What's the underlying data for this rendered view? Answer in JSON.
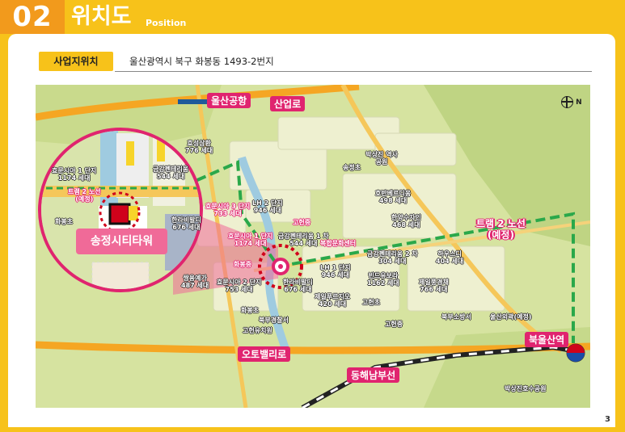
{
  "header": {
    "number": "02",
    "title": "위치도",
    "subtitle": "Position"
  },
  "location": {
    "tab_label": "사업지위치",
    "address": "울산광역시 북구 화봉동 1493-2번지"
  },
  "page_number": "3",
  "map": {
    "compass": "N",
    "roads": {
      "airport": "울산공항",
      "sanup": "산업로",
      "otovalley": "오토밸리로",
      "donghae": "동해남부선",
      "station": "북울산역"
    },
    "tram": {
      "line1": "트램 2 노선",
      "line2": "(예정)"
    },
    "inset": {
      "tram_line1": "트램 2 노선",
      "tram_line2": "(예정)",
      "school": "화봉초",
      "tower": "송정시티타워"
    },
    "labels": [
      {
        "id": "l1",
        "line1": "효성삼환",
        "line2": "776 세대"
      },
      {
        "id": "l2",
        "line1": "효문시아 1 단지",
        "line2": "1174 세대"
      },
      {
        "id": "l3",
        "line1": "금강펜테리움",
        "line2": "544 세대"
      },
      {
        "id": "l4",
        "line1": "한라비발디",
        "line2": "676 세대"
      },
      {
        "id": "l5",
        "line1": "쌍용예가",
        "line2": "487 세대"
      },
      {
        "id": "l6",
        "line1": "효문시아 3 단지",
        "line2": "733 세대"
      },
      {
        "id": "l7",
        "line1": "LH 2 단지",
        "line2": "946 세대"
      },
      {
        "id": "l8",
        "line1": "효문시아 1 단지",
        "line2": "1174 세대"
      },
      {
        "id": "l9",
        "line1": "금강펜테리움 1 차",
        "line2": "544 세대"
      },
      {
        "id": "l10",
        "line1": "효문시아 2 단지",
        "line2": "753 세대"
      },
      {
        "id": "l11",
        "line1": "한라비발디",
        "line2": "676 세대"
      },
      {
        "id": "l12",
        "line1": "LH 1 단지",
        "line2": "946 세대"
      },
      {
        "id": "l13",
        "line1": "제일푸르지오",
        "line2": "420 세대"
      },
      {
        "id": "l14",
        "line1": "호반베르디움",
        "line2": "498 세대"
      },
      {
        "id": "l15",
        "line1": "한양수자인",
        "line2": "468 세대"
      },
      {
        "id": "l16",
        "line1": "금강펜테리움 2 차",
        "line2": "304 세대"
      },
      {
        "id": "l17",
        "line1": "하우스디",
        "line2": "404 세대"
      },
      {
        "id": "l18",
        "line1": "빈드유보라",
        "line2": "1162 세대"
      },
      {
        "id": "l19",
        "line1": "제일풍경채",
        "line2": "766 세대"
      }
    ],
    "places": {
      "p1": "박상진 역사공원",
      "p2": "송정초",
      "p3": "고헌중",
      "p4": "복합문화센터",
      "p5": "화봉중",
      "p6": "화봉초",
      "p7": "고헌유치원",
      "p8": "북부경찰서",
      "p9": "고헌초",
      "p10": "고헌중",
      "p11": "북부소방서",
      "p12": "울산외곽(예정)",
      "p13": "박상진호수공원"
    }
  },
  "colors": {
    "accent_orange": "#f29a1c",
    "accent_yellow": "#f7c21a",
    "pink": "#e0246f",
    "tram_green": "#2aa84a"
  }
}
